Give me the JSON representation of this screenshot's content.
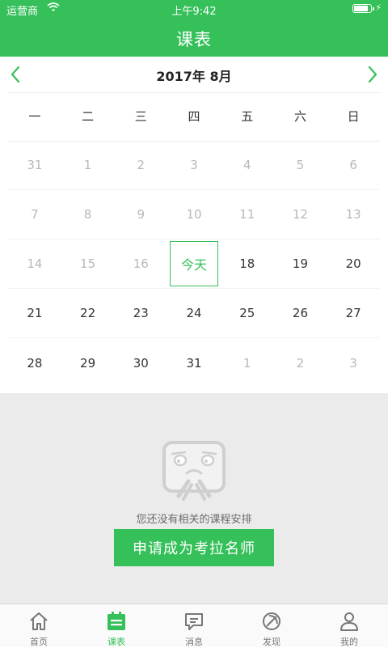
{
  "status_bar": {
    "carrier": "运营商",
    "time": "上午9:42",
    "battery_level": 0.95
  },
  "header": {
    "title": "课表"
  },
  "calendar": {
    "month_label": "2017年  8月",
    "weekdays": [
      "一",
      "二",
      "三",
      "四",
      "五",
      "六",
      "日"
    ],
    "weeks": [
      [
        {
          "label": "31",
          "muted": true
        },
        {
          "label": "1",
          "muted": true
        },
        {
          "label": "2",
          "muted": true
        },
        {
          "label": "3",
          "muted": true
        },
        {
          "label": "4",
          "muted": true
        },
        {
          "label": "5",
          "muted": true
        },
        {
          "label": "6",
          "muted": true
        }
      ],
      [
        {
          "label": "7",
          "muted": true
        },
        {
          "label": "8",
          "muted": true
        },
        {
          "label": "9",
          "muted": true
        },
        {
          "label": "10",
          "muted": true
        },
        {
          "label": "11",
          "muted": true
        },
        {
          "label": "12",
          "muted": true
        },
        {
          "label": "13",
          "muted": true
        }
      ],
      [
        {
          "label": "14",
          "muted": true
        },
        {
          "label": "15",
          "muted": true
        },
        {
          "label": "16",
          "muted": true
        },
        {
          "label": "今天",
          "today": true
        },
        {
          "label": "18"
        },
        {
          "label": "19"
        },
        {
          "label": "20"
        }
      ],
      [
        {
          "label": "21"
        },
        {
          "label": "22"
        },
        {
          "label": "23"
        },
        {
          "label": "24"
        },
        {
          "label": "25"
        },
        {
          "label": "26"
        },
        {
          "label": "27"
        }
      ],
      [
        {
          "label": "28"
        },
        {
          "label": "29"
        },
        {
          "label": "30"
        },
        {
          "label": "31"
        },
        {
          "label": "1",
          "muted": true
        },
        {
          "label": "2",
          "muted": true
        },
        {
          "label": "3",
          "muted": true
        }
      ]
    ]
  },
  "empty_state": {
    "message": "您还没有相关的课程安排",
    "button_label": "申请成为考拉名师"
  },
  "tab_bar": {
    "items": [
      {
        "label": "首页",
        "icon": "home-icon"
      },
      {
        "label": "课表",
        "icon": "calendar-icon",
        "active": true
      },
      {
        "label": "消息",
        "icon": "message-icon"
      },
      {
        "label": "发现",
        "icon": "discover-icon"
      },
      {
        "label": "我的",
        "icon": "profile-icon"
      }
    ]
  },
  "colors": {
    "accent": "#35c05a",
    "muted_text": "#b8b8b8",
    "empty_bg": "#ebebeb"
  }
}
